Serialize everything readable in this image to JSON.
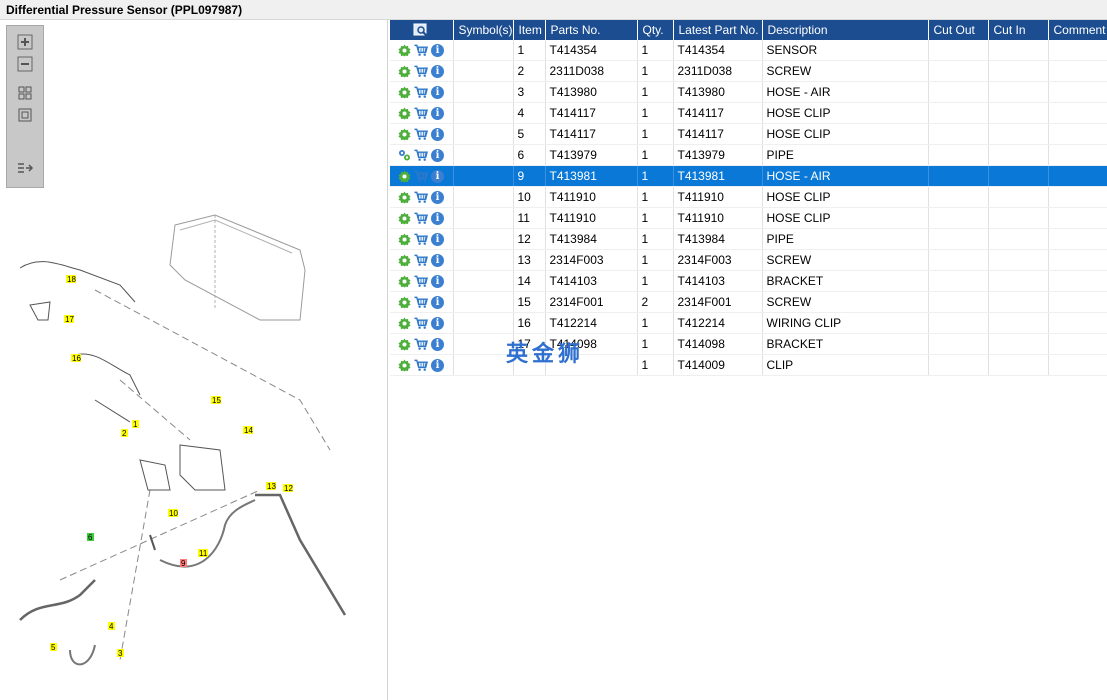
{
  "window": {
    "title": "Differential Pressure Sensor (PPL097987)"
  },
  "toolbox": {
    "buttons": [
      {
        "name": "zoom-in-icon"
      },
      {
        "name": "zoom-out-icon"
      },
      {
        "name": "fit-all-icon"
      },
      {
        "name": "fit-window-icon"
      },
      {
        "name": "toggle-list-icon"
      }
    ]
  },
  "diagram": {
    "callouts": [
      {
        "label": "18",
        "color": "#ffff00"
      },
      {
        "label": "17",
        "color": "#ffff00"
      },
      {
        "label": "16",
        "color": "#ffff00"
      },
      {
        "label": "15",
        "color": "#ffff00"
      },
      {
        "label": "14",
        "color": "#ffff00"
      },
      {
        "label": "2",
        "color": "#ffff00"
      },
      {
        "label": "1",
        "color": "#ffff00"
      },
      {
        "label": "13",
        "color": "#ffff00"
      },
      {
        "label": "12",
        "color": "#ffff00"
      },
      {
        "label": "10",
        "color": "#ffff00"
      },
      {
        "label": "6",
        "color": "#3ccf3c"
      },
      {
        "label": "11",
        "color": "#ffff00"
      },
      {
        "label": "9",
        "color": "#ff7b7b"
      },
      {
        "label": "4",
        "color": "#ffff00"
      },
      {
        "label": "5",
        "color": "#ffff00"
      },
      {
        "label": "3",
        "color": "#ffff00"
      }
    ]
  },
  "table": {
    "headers": [
      "",
      "Symbol(s)",
      "Item",
      "Parts No.",
      "Qty.",
      "Latest Part No.",
      "Description",
      "Cut Out",
      "Cut In",
      "Comment"
    ],
    "rows": [
      {
        "item": "1",
        "part": "T414354",
        "qty": "1",
        "latest": "T414354",
        "desc": "SENSOR",
        "selected": false,
        "gear": "gear-icon"
      },
      {
        "item": "2",
        "part": "2311D038",
        "qty": "1",
        "latest": "2311D038",
        "desc": "SCREW",
        "selected": false,
        "gear": "gear-icon"
      },
      {
        "item": "3",
        "part": "T413980",
        "qty": "1",
        "latest": "T413980",
        "desc": "HOSE - AIR",
        "selected": false,
        "gear": "gear-icon"
      },
      {
        "item": "4",
        "part": "T414117",
        "qty": "1",
        "latest": "T414117",
        "desc": "HOSE CLIP",
        "selected": false,
        "gear": "gear-icon"
      },
      {
        "item": "5",
        "part": "T414117",
        "qty": "1",
        "latest": "T414117",
        "desc": "HOSE CLIP",
        "selected": false,
        "gear": "gear-icon"
      },
      {
        "item": "6",
        "part": "T413979",
        "qty": "1",
        "latest": "T413979",
        "desc": "PIPE",
        "selected": false,
        "gear": "gears-icon"
      },
      {
        "item": "9",
        "part": "T413981",
        "qty": "1",
        "latest": "T413981",
        "desc": "HOSE - AIR",
        "selected": true,
        "gear": "gear-icon"
      },
      {
        "item": "10",
        "part": "T411910",
        "qty": "1",
        "latest": "T411910",
        "desc": "HOSE CLIP",
        "selected": false,
        "gear": "gear-icon"
      },
      {
        "item": "11",
        "part": "T411910",
        "qty": "1",
        "latest": "T411910",
        "desc": "HOSE CLIP",
        "selected": false,
        "gear": "gear-icon"
      },
      {
        "item": "12",
        "part": "T413984",
        "qty": "1",
        "latest": "T413984",
        "desc": "PIPE",
        "selected": false,
        "gear": "gear-icon"
      },
      {
        "item": "13",
        "part": "2314F003",
        "qty": "1",
        "latest": "2314F003",
        "desc": "SCREW",
        "selected": false,
        "gear": "gear-icon"
      },
      {
        "item": "14",
        "part": "T414103",
        "qty": "1",
        "latest": "T414103",
        "desc": "BRACKET",
        "selected": false,
        "gear": "gear-icon"
      },
      {
        "item": "15",
        "part": "2314F001",
        "qty": "2",
        "latest": "2314F001",
        "desc": "SCREW",
        "selected": false,
        "gear": "gear-icon"
      },
      {
        "item": "16",
        "part": "T412214",
        "qty": "1",
        "latest": "T412214",
        "desc": "WIRING CLIP",
        "selected": false,
        "gear": "gear-icon"
      },
      {
        "item": "17",
        "part": "T414098",
        "qty": "1",
        "latest": "T414098",
        "desc": "BRACKET",
        "selected": false,
        "gear": "gear-icon"
      },
      {
        "item": "",
        "part": "",
        "qty": "1",
        "latest": "T414009",
        "desc": "CLIP",
        "selected": false,
        "gear": "gear-icon"
      }
    ]
  },
  "watermark": "英金狮",
  "colors": {
    "header_bg": "#1c4d91",
    "selected_row": "#0a78d7",
    "gear": "#4caf3a",
    "cart": "#2f78c8"
  }
}
